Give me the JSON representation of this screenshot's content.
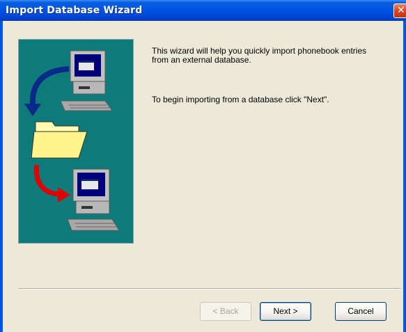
{
  "window": {
    "title": "Import Database Wizard"
  },
  "content": {
    "intro": "This wizard will help you quickly import phonebook entries from an external database.",
    "instruction": "To begin importing from a database click \"Next\"."
  },
  "buttons": {
    "back": "< Back",
    "next": "Next >",
    "cancel": "Cancel"
  },
  "icons": {
    "close": "close-icon",
    "illustration": "wizard-illustration"
  },
  "colors": {
    "title_bar": "#0054e3",
    "panel_bg": "#0f7a7a",
    "dialog_bg": "#ece9d8"
  }
}
